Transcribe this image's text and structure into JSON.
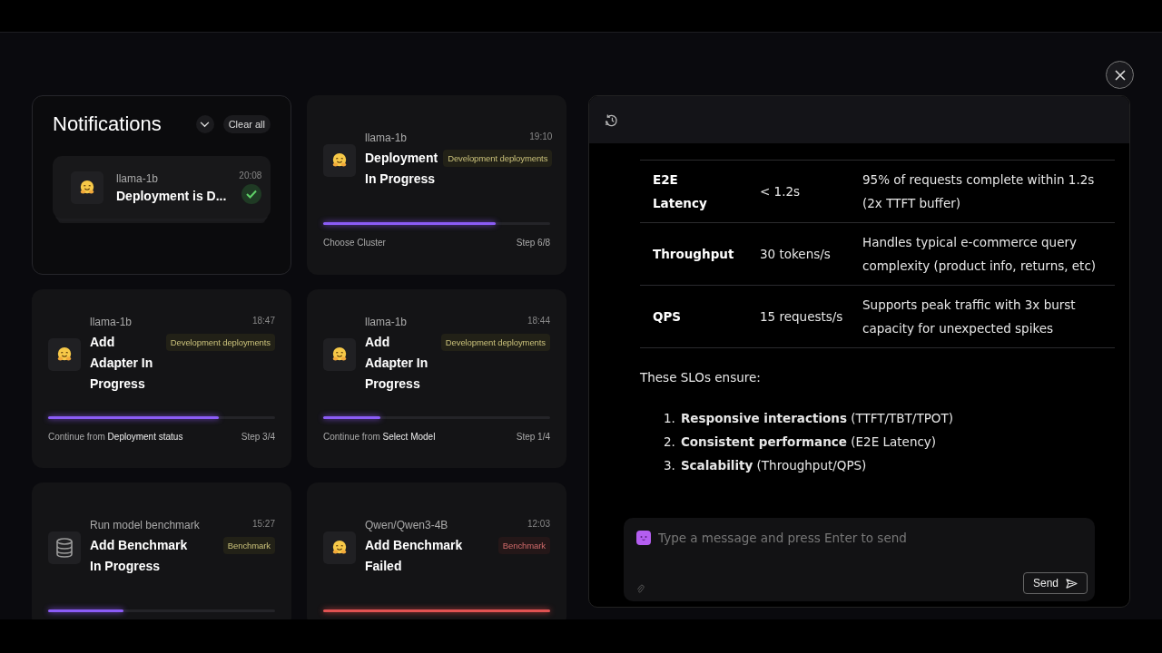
{
  "notifications": {
    "title": "Notifications",
    "clear_label": "Clear all",
    "summary": {
      "kind": "emoji",
      "source": "llama-1b",
      "title": "Deployment is D...",
      "time": "20:08",
      "done": true
    },
    "cards": [
      {
        "kind": "emoji",
        "source": "llama-1b",
        "time": "19:10",
        "title": "Deployment In Progress",
        "tag": {
          "label": "Development deployments",
          "kind": "neutral"
        },
        "failed": false,
        "level": 0.76,
        "footer": "Choose Cluster",
        "step": "Step 6/8"
      },
      {
        "kind": "emoji",
        "source": "llama-1b",
        "time": "18:47",
        "title": "Add Adapter In Progress",
        "tag": {
          "label": "Development deployments",
          "kind": "neutral"
        },
        "failed": false,
        "level": 0.75,
        "footer": "Continue from **Deployment status**",
        "step": "Step 3/4"
      },
      {
        "kind": "emoji",
        "source": "llama-1b",
        "time": "18:44",
        "title": "Add Adapter In Progress",
        "tag": {
          "label": "Development deployments",
          "kind": "neutral"
        },
        "failed": false,
        "level": 0.25,
        "footer": "Continue from **Select Model**",
        "step": "Step 1/4"
      },
      {
        "kind": "database",
        "source": "Run model benchmark",
        "time": "15:27",
        "title": "Add Benchmark In Progress",
        "tag": {
          "label": "Benchmark",
          "kind": "neutral"
        },
        "failed": false,
        "level": 0.33
      },
      {
        "kind": "emoji",
        "source": "Qwen/Qwen3-4B",
        "time": "12:03",
        "title": "Add Benchmark Failed",
        "tag": {
          "label": "Benchmark",
          "kind": "error"
        },
        "failed": true,
        "level": 1.0
      }
    ]
  },
  "chat": {
    "table": [
      {
        "metric": "E2E Latency",
        "target": "< 1.2s",
        "description": "95% of requests complete within 1.2s (2x TTFT buffer)"
      },
      {
        "metric": "Throughput",
        "target": "30 tokens/s",
        "description": "Handles typical e-commerce query complexity (product info, returns, etc)"
      },
      {
        "metric": "QPS",
        "target": "15 requests/s",
        "description": "Supports peak traffic with 3x burst capacity for unexpected spikes"
      }
    ],
    "paragraph": "These SLOs ensure:",
    "list": [
      {
        "number": "1.",
        "text": "**Responsive interactions** (TTFT/TBT/TPOT)"
      },
      {
        "number": "2.",
        "text": "**Consistent performance** (E2E Latency)"
      },
      {
        "number": "3.",
        "text": "**Scalability** (Throughput/QPS)"
      }
    ],
    "input": {
      "placeholder": "Type a message and press Enter to send"
    },
    "send_label": "Send"
  }
}
